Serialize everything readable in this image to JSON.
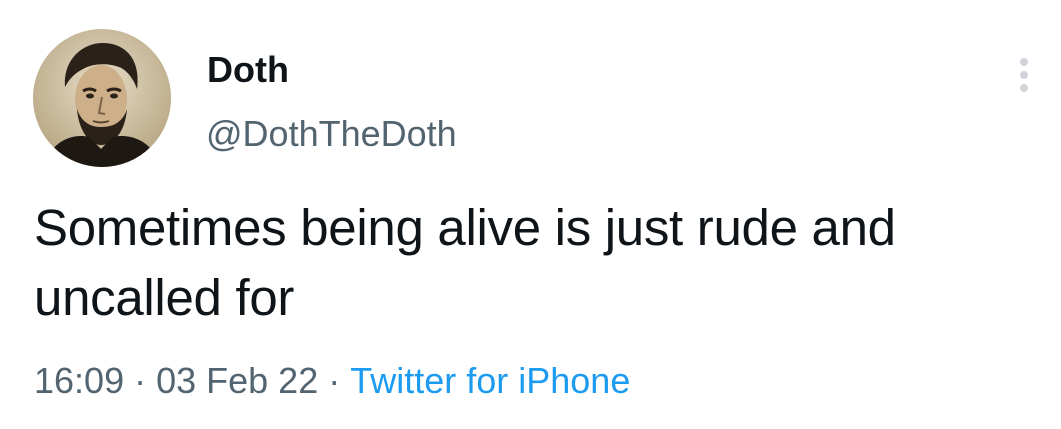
{
  "tweet": {
    "author": {
      "display_name": "Doth",
      "handle": "@DothTheDoth",
      "avatar": "portrait-photo-icon"
    },
    "more_icon": "more-vertical-icon",
    "text": "Sometimes being alive is just rude and uncalled for",
    "time": "16:09",
    "date": "03 Feb 22",
    "separator": "·",
    "source": "Twitter for iPhone"
  },
  "colors": {
    "text_primary": "#0f1419",
    "text_secondary": "#536471",
    "link": "#1d9bf0",
    "background": "#ffffff"
  }
}
